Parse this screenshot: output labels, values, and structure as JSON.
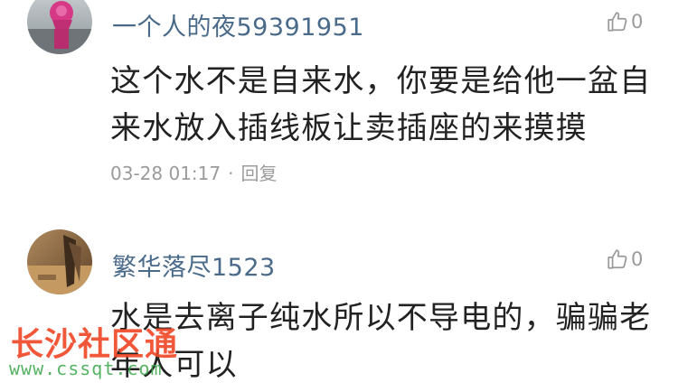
{
  "comments": [
    {
      "username": "一个人的夜59391951",
      "likes": "0",
      "lines": [
        "这个水不是自来水，你要是给他一盆自",
        "来水放入插线板让卖插座的来摸摸"
      ],
      "time": "03-28 01:17",
      "separator": "·",
      "reply_label": "回复"
    },
    {
      "username": "繁华落尽1523",
      "likes": "0",
      "lines": [
        "水是去离子纯水所以不导电的，骗骗老",
        "年人可以"
      ]
    }
  ],
  "watermark": {
    "title": "长沙社区通",
    "url": "www.cssqt.com"
  },
  "colors": {
    "username": "#4a6a8a",
    "meta": "#9b9b9b",
    "watermark_red": "#f04a2a",
    "watermark_green": "#3aa64a"
  },
  "icons": {
    "like": "thumbs-up-icon"
  }
}
